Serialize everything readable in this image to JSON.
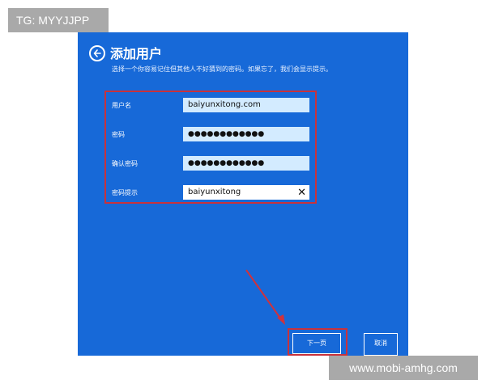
{
  "watermarks": {
    "top_left": "TG: MYYJJPP",
    "bottom_right": "www.mobi-amhg.com"
  },
  "dialog": {
    "title": "添加用户",
    "subtitle": "选择一个你容易记住但其他人不好猜到的密码。如果忘了，我们会显示提示。",
    "fields": [
      {
        "label": "用户名",
        "value": "baiyunxitong.com"
      },
      {
        "label": "密码",
        "value": "●●●●●●●●●●●●"
      },
      {
        "label": "确认密码",
        "value": "●●●●●●●●●●●●"
      },
      {
        "label": "密码提示",
        "value": "baiyunxitong"
      }
    ],
    "buttons": {
      "next": "下一页",
      "cancel": "取消"
    }
  },
  "colors": {
    "background": "#1769d8",
    "highlight": "#c8323c"
  },
  "icons": {
    "back": "back-arrow-icon",
    "clear": "clear-x-icon"
  }
}
